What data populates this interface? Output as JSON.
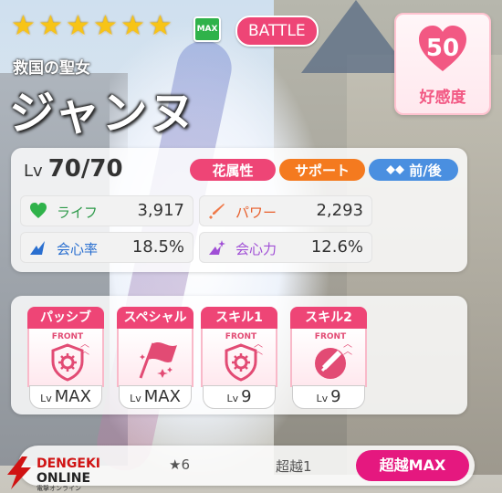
{
  "header": {
    "stars": [
      "★",
      "★",
      "★",
      "★",
      "★",
      "★"
    ],
    "max_badge": "MAX",
    "mode_badge": "BATTLE",
    "subtitle": "救国の聖女",
    "name": "ジャンヌ"
  },
  "affection": {
    "value": "50",
    "label": "好感度",
    "color": "#f25883"
  },
  "stats": {
    "level_label": "Lv",
    "level_value": "70/70",
    "tags": {
      "attribute": "花属性",
      "role": "サポート",
      "position": "前/後"
    },
    "life": {
      "label": "ライフ",
      "value": "3,917",
      "icon": "heart-icon"
    },
    "power": {
      "label": "パワー",
      "value": "2,293",
      "icon": "sword-icon"
    },
    "crit_rate": {
      "label": "会心率",
      "value": "18.5%",
      "icon": "crit-rate-icon"
    },
    "crit_power": {
      "label": "会心力",
      "value": "12.6%",
      "icon": "crit-power-icon"
    }
  },
  "skills": [
    {
      "title": "パッシブ",
      "tag": "FRONT",
      "level_label": "Lv",
      "level": "MAX",
      "icon": "shield-gear-icon"
    },
    {
      "title": "スペシャル",
      "tag": "",
      "level_label": "Lv",
      "level": "MAX",
      "icon": "flag-icon"
    },
    {
      "title": "スキル1",
      "tag": "FRONT",
      "level_label": "Lv",
      "level": "9",
      "icon": "shield-gear-icon"
    },
    {
      "title": "スキル2",
      "tag": "FRONT",
      "level_label": "Lv",
      "level": "9",
      "icon": "sword-circle-icon"
    }
  ],
  "bottom_bar": {
    "stars": "★6",
    "overlimit": "超越1",
    "overlimit_max": "超越MAX"
  },
  "watermark": {
    "line1": "DENGEKI",
    "line2": "ONLINE",
    "line3": "電撃オンライン"
  },
  "colors": {
    "pink": "#ee4576",
    "orange": "#f47a1f",
    "blue": "#4a8fe0",
    "magenta": "#e5187f",
    "green": "#2fb24a"
  }
}
